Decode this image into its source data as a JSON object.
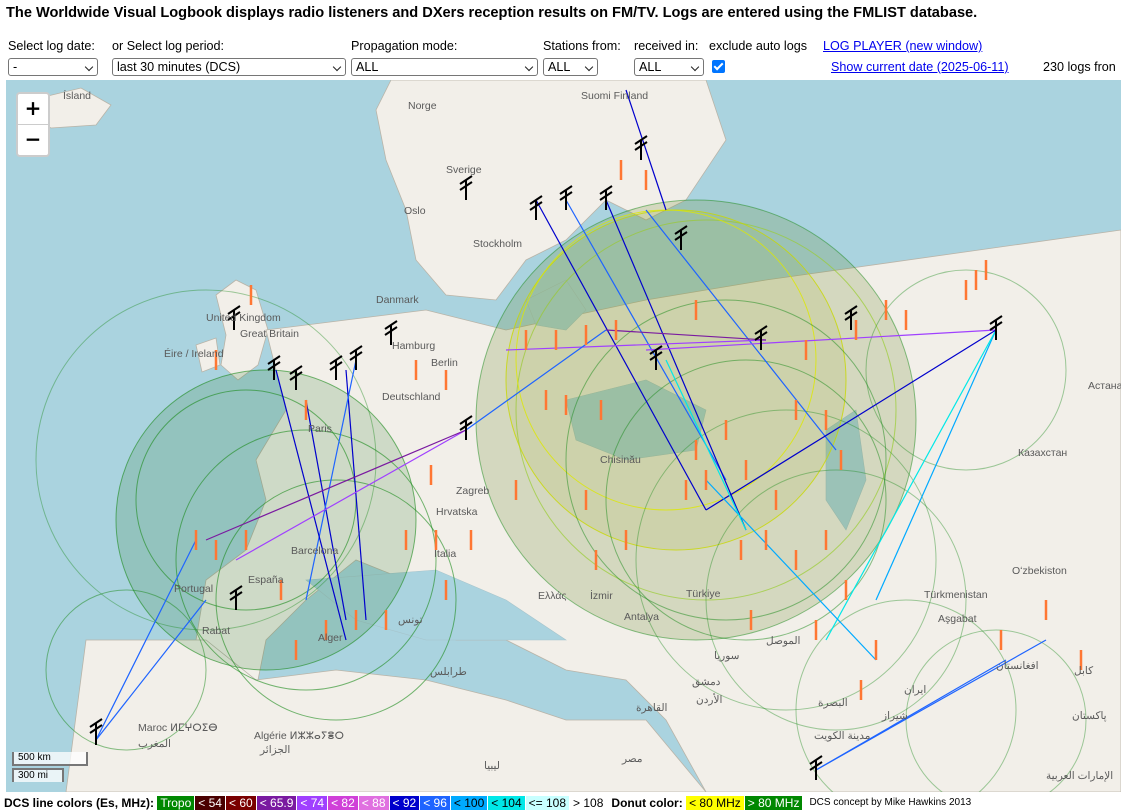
{
  "header": {
    "title": "The Worldwide Visual Logbook displays radio listeners and DXers reception results on FM/TV. Logs are entered using the FMLIST database."
  },
  "controls": {
    "log_date_label": "Select log date:",
    "log_date_value": "-",
    "log_period_label": "or Select log period:",
    "log_period_value": "last 30 minutes (DCS)",
    "propagation_label": "Propagation mode:",
    "propagation_value": "ALL",
    "stations_from_label": "Stations from:",
    "stations_from_value": "ALL",
    "received_in_label": "received in:",
    "received_in_value": "ALL",
    "exclude_auto_label": "exclude auto logs",
    "exclude_auto_checked": true,
    "log_player_link": "LOG PLAYER (new window)",
    "show_date_link": "Show current date (2025-06-11)",
    "logs_count": "230 logs fron"
  },
  "map": {
    "zoom_in": "+",
    "zoom_out": "−",
    "scale_km": "500 km",
    "scale_mi": "300 mi",
    "labels": [
      "Ísland",
      "Norge",
      "Sverige",
      "Suomi Finland",
      "Oslo",
      "Stockholm",
      "Danmark",
      "United Kingdom",
      "Great Britain",
      "Éire / Ireland",
      "Hamburg",
      "Berlin",
      "Deutschland",
      "Paris",
      "Zagreb",
      "Hrvatska",
      "Chisinău",
      "Barcelona",
      "Italia",
      "España",
      "Portugal",
      "Rabat",
      "Alger",
      "Ελλάς",
      "İzmir",
      "Türkiye",
      "Antalya",
      "Казахстан",
      "Oʻzbekiston",
      "Türkmenistan",
      "Aşgabat",
      "Астана",
      "Maroc ⵍⵎⵖⵔⵉⴱ",
      "Algérie ⵍⵣⵣⴰⵢⴻⵔ",
      "ليبيا",
      "مصر",
      "القاهرة",
      "سوريا",
      "الموصل",
      "دمشق",
      "الأردن",
      "البصرة",
      "ایران",
      "شیراز",
      "افغانستان",
      "كابل",
      "پاکستان",
      "تونس",
      "طرابلس",
      "المغرب",
      "الجزائر",
      "مدينة الكويت",
      "الإمارات العربية"
    ]
  },
  "legend": {
    "dcs_label": "DCS line colors (Es, MHz):",
    "items": [
      {
        "label": "Tropo",
        "bg": "#008800",
        "fg": "#ffffff"
      },
      {
        "label": "< 54",
        "bg": "#4a0000",
        "fg": "#ffffff"
      },
      {
        "label": "< 60",
        "bg": "#7a0000",
        "fg": "#ffffff"
      },
      {
        "label": "< 65.9",
        "bg": "#7a1aa0",
        "fg": "#ffffff"
      },
      {
        "label": "< 74",
        "bg": "#a040ff",
        "fg": "#ffffff"
      },
      {
        "label": "< 82",
        "bg": "#d040d8",
        "fg": "#ffffff"
      },
      {
        "label": "< 88",
        "bg": "#e070e0",
        "fg": "#ffffff"
      },
      {
        "label": "< 92",
        "bg": "#0000cc",
        "fg": "#ffffff"
      },
      {
        "label": "< 96",
        "bg": "#1e64ff",
        "fg": "#ffffff"
      },
      {
        "label": "< 100",
        "bg": "#00aaff",
        "fg": "#000000"
      },
      {
        "label": "< 104",
        "bg": "#00e8e8",
        "fg": "#000000"
      },
      {
        "label": "<= 108",
        "bg": "#c8ffff",
        "fg": "#000000"
      },
      {
        "label": "> 108",
        "bg": "#ffffff",
        "fg": "#000000"
      }
    ],
    "donut_label": "Donut color:",
    "donut_items": [
      {
        "label": "< 80 MHz",
        "bg": "#ffff00",
        "fg": "#000000"
      },
      {
        "label": "> 80 MHz",
        "bg": "#008800",
        "fg": "#ffffff"
      }
    ],
    "credit": "DCS concept by Mike Hawkins 2013"
  }
}
